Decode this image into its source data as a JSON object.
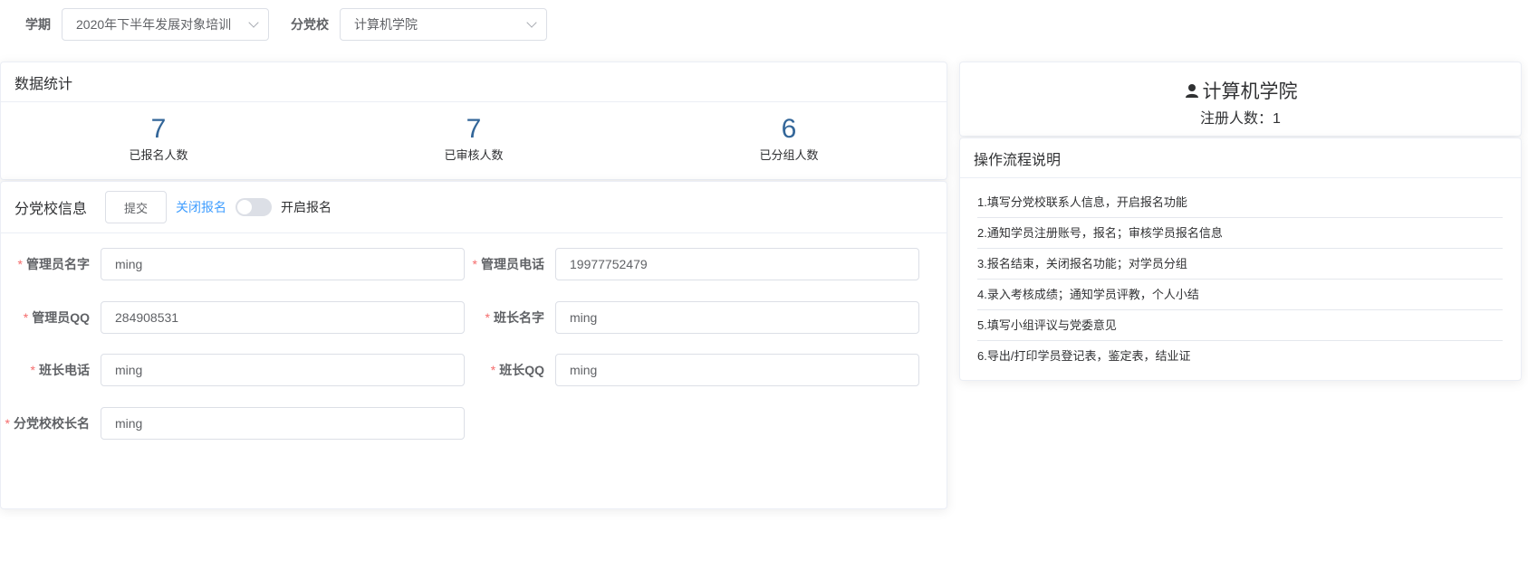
{
  "filters": {
    "term_label": "学期",
    "term_value": "2020年下半年发展对象培训",
    "branch_label": "分党校",
    "branch_value": "计算机学院"
  },
  "stats_card": {
    "title": "数据统计",
    "items": [
      {
        "value": "7",
        "label": "已报名人数"
      },
      {
        "value": "7",
        "label": "已审核人数"
      },
      {
        "value": "6",
        "label": "已分组人数"
      }
    ]
  },
  "info_card": {
    "title": "分党校信息",
    "submit_label": "提交",
    "switch_off_label": "关闭报名",
    "switch_on_label": "开启报名",
    "switch_on": false,
    "required_mark": "*",
    "fields": {
      "admin_name": {
        "label": "管理员名字",
        "value": "ming"
      },
      "admin_phone": {
        "label": "管理员电话",
        "value": "19977752479"
      },
      "admin_qq": {
        "label": "管理员QQ",
        "value": "284908531"
      },
      "monitor_name": {
        "label": "班长名字",
        "value": "ming"
      },
      "monitor_phone": {
        "label": "班长电话",
        "value": "ming"
      },
      "monitor_qq": {
        "label": "班长QQ",
        "value": "ming"
      },
      "principal_name": {
        "label": "分党校校长名",
        "value": "ming"
      }
    }
  },
  "profile": {
    "icon": "user-icon",
    "name": "计算机学院",
    "count_text": "注册人数：1"
  },
  "process_card": {
    "title": "操作流程说明",
    "steps": [
      "1.填写分党校联系人信息，开启报名功能",
      "2.通知学员注册账号，报名；审核学员报名信息",
      "3.报名结束，关闭报名功能；对学员分组",
      "4.录入考核成绩；通知学员评教，个人小结",
      "5.填写小组评议与党委意见",
      "6.导出/打印学员登记表，鉴定表，结业证"
    ]
  },
  "colors": {
    "accent": "#409eff",
    "stat_number": "#336699",
    "required": "#f56c6c"
  }
}
